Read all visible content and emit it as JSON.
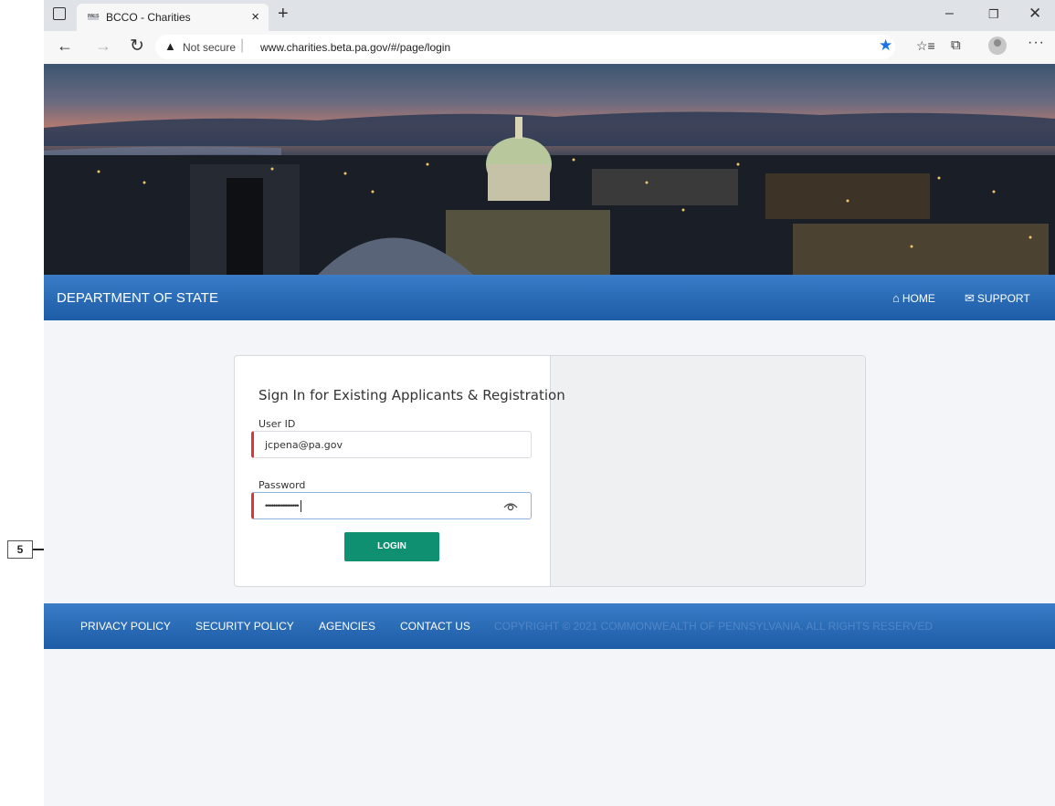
{
  "browser": {
    "tab_title": "BCCO - Charities",
    "tab_favicon_text": "PALS",
    "tab_close": "×",
    "new_tab": "+",
    "security_label": "Not secure",
    "url": "www.charities.beta.pa.gov/#/page/login",
    "window_controls": {
      "minimize": "–",
      "maximize": "❐",
      "close": "✕"
    },
    "nav": {
      "back": "←",
      "forward": "→",
      "reload": "↻"
    }
  },
  "header": {
    "title": "DEPARTMENT OF STATE",
    "home_label": "HOME",
    "support_label": "SUPPORT"
  },
  "login": {
    "title": "Sign In for Existing Applicants & Registration",
    "user_id_label": "User ID",
    "user_id_value": "jcpena@pa.gov",
    "password_label": "Password",
    "password_mask": "•••••••••••••••••",
    "button_label": "LOGIN"
  },
  "footer": {
    "privacy": "PRIVACY POLICY",
    "security": "SECURITY POLICY",
    "agencies": "AGENCIES",
    "contact": "CONTACT US",
    "copyright": "COPYRIGHT © 2021 COMMONWEALTH OF PENNSYLVANIA. ALL RIGHTS RESERVED"
  },
  "callout": {
    "number": "5"
  },
  "colors": {
    "header_blue": "#1d5ca7",
    "login_green": "#0f9171",
    "required_red": "#d9363e",
    "star_blue": "#1a73e8"
  },
  "icons": [
    "sidebar-icon",
    "warning-icon",
    "star-icon",
    "favorites-icon",
    "collections-icon",
    "profile-icon",
    "more-icon",
    "home-icon",
    "mail-icon",
    "eye-icon"
  ]
}
